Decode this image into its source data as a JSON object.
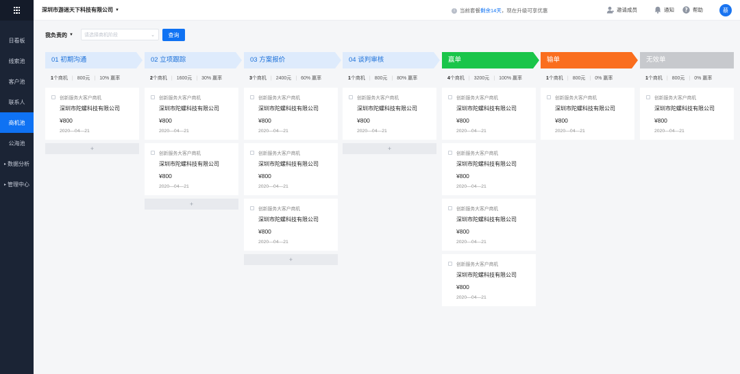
{
  "sidebar": {
    "menu_icon": "grid-icon",
    "items": [
      {
        "label": "日看板",
        "active": false
      },
      {
        "label": "线索池",
        "active": false
      },
      {
        "label": "客户池",
        "active": false
      },
      {
        "label": "联系人",
        "active": false
      },
      {
        "label": "商机池",
        "active": true
      },
      {
        "label": "公海池",
        "active": false
      },
      {
        "label": "数据分析",
        "active": false,
        "expandable": true
      },
      {
        "label": "管理中心",
        "active": false,
        "expandable": true
      }
    ]
  },
  "header": {
    "company": "深圳市游迷天下科技有限公司",
    "notice_prefix": "当前套餐",
    "notice_highlight": "剩余14天",
    "notice_suffix": "，现在升级可享优惠",
    "invite": "邀请成员",
    "notify": "通知",
    "help": "帮助",
    "avatar": "蔡"
  },
  "filter": {
    "owner": "我负责的",
    "placeholder": "请选择商机阶段",
    "query": "查询"
  },
  "colors": {
    "stage_light": "#deebfc",
    "stage_text": "#1a6fd8",
    "won": "#1ac54a",
    "lost": "#fa6e1e",
    "invalid": "#c7c9cd",
    "primary": "#0f72f3",
    "sidebar_bg": "#1b2435"
  },
  "columns": [
    {
      "label": "01 初期沟通",
      "count": "1",
      "count_unit": "个商机",
      "amount": "800元",
      "rate": "10%",
      "rate_unit": "赢率",
      "add": "+",
      "cards": [
        {
          "tag": "创新服务大客户商机",
          "company": "深圳市陀螺科技有限公司",
          "amount": "¥800",
          "date": "2020—04—21"
        }
      ]
    },
    {
      "label": "02 立项跟踪",
      "count": "2",
      "count_unit": "个商机",
      "amount": "1600元",
      "rate": "30%",
      "rate_unit": "赢率",
      "add": "+",
      "cards": [
        {
          "tag": "创新服务大客户商机",
          "company": "深圳市陀螺科技有限公司",
          "amount": "¥800",
          "date": "2020—04—21"
        },
        {
          "tag": "创新服务大客户商机",
          "company": "深圳市陀螺科技有限公司",
          "amount": "¥800",
          "date": "2020—04—21"
        }
      ]
    },
    {
      "label": "03 方案报价",
      "count": "3",
      "count_unit": "个商机",
      "amount": "2400元",
      "rate": "60%",
      "rate_unit": "赢率",
      "add": "+",
      "cards": [
        {
          "tag": "创新服务大客户商机",
          "company": "深圳市陀螺科技有限公司",
          "amount": "¥800",
          "date": "2020—04—21"
        },
        {
          "tag": "创新服务大客户商机",
          "company": "深圳市陀螺科技有限公司",
          "amount": "¥800",
          "date": "2020—04—21"
        },
        {
          "tag": "创新服务大客户商机",
          "company": "深圳市陀螺科技有限公司",
          "amount": "¥800",
          "date": "2020—04—21"
        }
      ]
    },
    {
      "label": "04 谈判审核",
      "count": "1",
      "count_unit": "个商机",
      "amount": "800元",
      "rate": "80%",
      "rate_unit": "赢率",
      "add": "+",
      "cards": [
        {
          "tag": "创新服务大客户商机",
          "company": "深圳市陀螺科技有限公司",
          "amount": "¥800",
          "date": "2020—04—21"
        }
      ]
    },
    {
      "label": "赢单",
      "count": "4",
      "count_unit": "个商机",
      "amount": "3200元",
      "rate": "100%",
      "rate_unit": "赢率",
      "cards": [
        {
          "tag": "创新服务大客户商机",
          "company": "深圳市陀螺科技有限公司",
          "amount": "¥800",
          "date": "2020—04—21"
        },
        {
          "tag": "创新服务大客户商机",
          "company": "深圳市陀螺科技有限公司",
          "amount": "¥800",
          "date": "2020—04—21"
        },
        {
          "tag": "创新服务大客户商机",
          "company": "深圳市陀螺科技有限公司",
          "amount": "¥800",
          "date": "2020—04—21"
        },
        {
          "tag": "创新服务大客户商机",
          "company": "深圳市陀螺科技有限公司",
          "amount": "¥800",
          "date": "2020—04—21"
        }
      ]
    },
    {
      "label": "输单",
      "count": "1",
      "count_unit": "个商机",
      "amount": "800元",
      "rate": "0%",
      "rate_unit": "赢率",
      "cards": [
        {
          "tag": "创新服务大客户商机",
          "company": "深圳市陀螺科技有限公司",
          "amount": "¥800",
          "date": "2020—04—21"
        }
      ]
    },
    {
      "label": "无效单",
      "count": "1",
      "count_unit": "个商机",
      "amount": "800元",
      "rate": "0%",
      "rate_unit": "赢率",
      "cards": [
        {
          "tag": "创新服务大客户商机",
          "company": "深圳市陀螺科技有限公司",
          "amount": "¥800",
          "date": "2020—04—21"
        }
      ]
    }
  ]
}
